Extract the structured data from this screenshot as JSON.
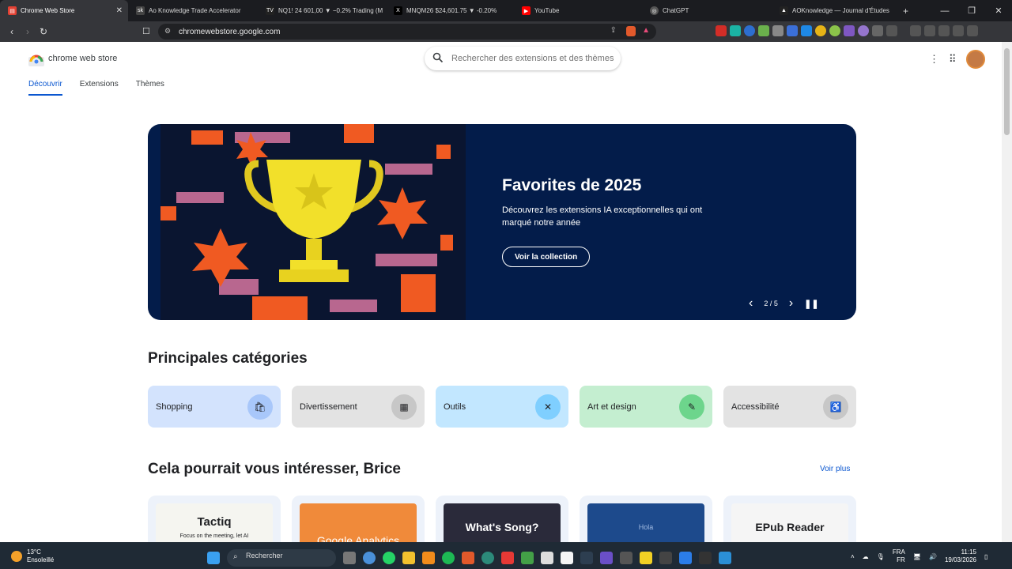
{
  "browser": {
    "tabs": [
      {
        "label": "Chrome Web Store",
        "color": "#e34133",
        "active": true
      },
      {
        "label": "Ao Knowledge Trade Accelerator",
        "color": "#ffffff"
      },
      {
        "label": "NQ1! 24 601,00 ▼ −0.2% Trading (M",
        "color": "#ffffff"
      },
      {
        "label": "MNQM26 $24,601.75 ▼ -0.20%",
        "color": "#ffffff"
      },
      {
        "label": "YouTube",
        "color": "#ff0000"
      },
      {
        "label": "ChatGPT",
        "color": "#ffffff"
      },
      {
        "label": "AOKnowledge — Journal d'Études",
        "color": "#ffffff"
      }
    ],
    "url": "chromewebstore.google.com"
  },
  "store": {
    "logo_text": "chrome web store",
    "search_placeholder": "Rechercher des extensions et des thèmes",
    "nav": [
      "Découvrir",
      "Extensions",
      "Thèmes"
    ]
  },
  "hero": {
    "title": "Favorites de 2025",
    "description": "Découvrez les extensions IA exceptionnelles qui ont marqué notre année",
    "button": "Voir la collection",
    "pager": "2 / 5"
  },
  "categories": {
    "title": "Principales catégories",
    "items": [
      {
        "label": "Shopping",
        "bg": "#d3e3fd",
        "icon_bg": "#a8c7fa",
        "icon": "shopping-bag-icon"
      },
      {
        "label": "Divertissement",
        "bg": "#e3e3e3",
        "icon_bg": "#c7c7c7",
        "icon": "calendar-icon"
      },
      {
        "label": "Outils",
        "bg": "#c2e7ff",
        "icon_bg": "#7fcfff",
        "icon": "tools-icon"
      },
      {
        "label": "Art et design",
        "bg": "#c4eed0",
        "icon_bg": "#6dd58c",
        "icon": "pencil-icon"
      },
      {
        "label": "Accessibilité",
        "bg": "#e3e3e3",
        "icon_bg": "#c7c7c7",
        "icon": "accessibility-icon"
      }
    ]
  },
  "recommend": {
    "title": "Cela pourrait vous intéresser, Brice",
    "see_more": "Voir plus",
    "cards": [
      {
        "title": "Tactiq",
        "subtitle": "Focus on the meeting, let AI",
        "bg": "#f5f5f0"
      },
      {
        "title": "Google Analytics",
        "bg": "#f08a3a"
      },
      {
        "title": "What's Song?",
        "bg": "#2a2a3a"
      },
      {
        "title": "Hola",
        "bg": "#1d4a8c"
      },
      {
        "title": "EPub Reader",
        "bg": "#f5f5f5"
      }
    ]
  },
  "taskbar": {
    "temp": "13°C",
    "weather": "Ensoleillé",
    "search": "Rechercher",
    "lang1": "FRA",
    "lang2": "FR",
    "time": "11:15",
    "date": "19/03/2026"
  }
}
